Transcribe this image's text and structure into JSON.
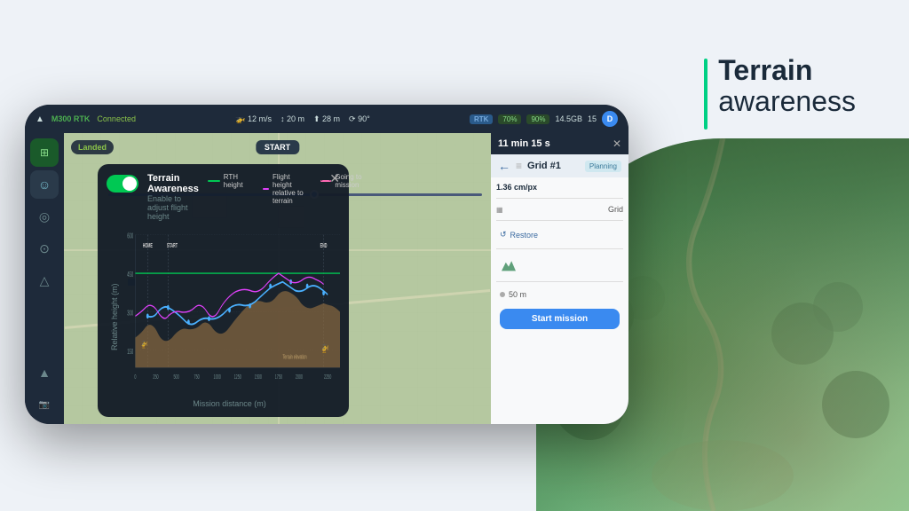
{
  "page": {
    "bg_color": "#f0f4f8"
  },
  "terrain_title": {
    "bold": "Terrain",
    "light": "awareness"
  },
  "status_bar": {
    "drone_name": "M300 RTK",
    "connection": "Connected",
    "speed": "12 m/s",
    "altitude": "20 m",
    "height": "28 m",
    "angle": "90°",
    "rtk_label": "RTK",
    "battery1": "70%",
    "battery2": "90%",
    "storage": "14.5GB",
    "signal": "15",
    "user_initial": "D"
  },
  "sidebar": {
    "icons": [
      "⊞",
      "☺",
      "◎",
      "⊙",
      "△",
      "▲"
    ]
  },
  "map": {
    "landed_label": "Landed",
    "start_label": "START"
  },
  "right_panel": {
    "time": "11 min 15 s",
    "close_label": "✕",
    "back_arrow": "←",
    "grid_title": "Grid #1",
    "planning_label": "Planning",
    "scale": "1.36 cm/px",
    "grid_label": "Grid",
    "restore_label": "Restore",
    "distance_label": "50 m",
    "start_mission_label": "Start mission"
  },
  "modal": {
    "close_label": "✕",
    "toggle_on": true,
    "title": "Terrain Awareness",
    "subtitle": "Enable to adjust flight height",
    "legend": [
      {
        "label": "RTH height",
        "color": "#00c853"
      },
      {
        "label": "Flight height relative to terrain",
        "color": "#e040fb"
      },
      {
        "label": "Going to mission",
        "color": "#e040fb"
      }
    ],
    "chart": {
      "y_axis_label": "Relative height (m)",
      "x_axis_label": "Mission distance (m)",
      "terrain_label": "Terrain elevation",
      "y_values": [
        "600",
        "450",
        "300",
        "150"
      ],
      "x_values": [
        "0",
        "250",
        "500",
        "750",
        "1000",
        "1250",
        "1500",
        "1750",
        "2000",
        "2250"
      ],
      "labels": {
        "home": "HOME",
        "start": "START",
        "end": "END"
      }
    }
  }
}
